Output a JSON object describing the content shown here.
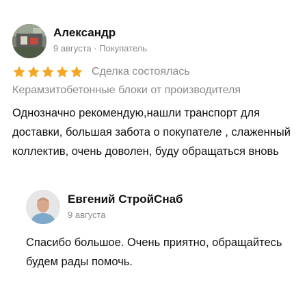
{
  "review": {
    "author": {
      "name": "Александр",
      "date": "9 августа",
      "separator": " · ",
      "role": "Покупатель"
    },
    "rating": {
      "stars": 5,
      "max": 5,
      "star_color": "#f5a623"
    },
    "deal_status": "Сделка состоялась",
    "product": "Керамзитобетонные блоки от производителя",
    "text": "Однозначно рекомендую,нашли транспорт для доставки, большая забота о покупателе , слаженный коллектив, очень доволен, буду обращаться вновь"
  },
  "reply": {
    "author": {
      "name": "Евгений СтройСнаб",
      "date": "9 августа"
    },
    "text": "Спасибо большое. Очень приятно, обращайтесь будем рады помочь."
  }
}
